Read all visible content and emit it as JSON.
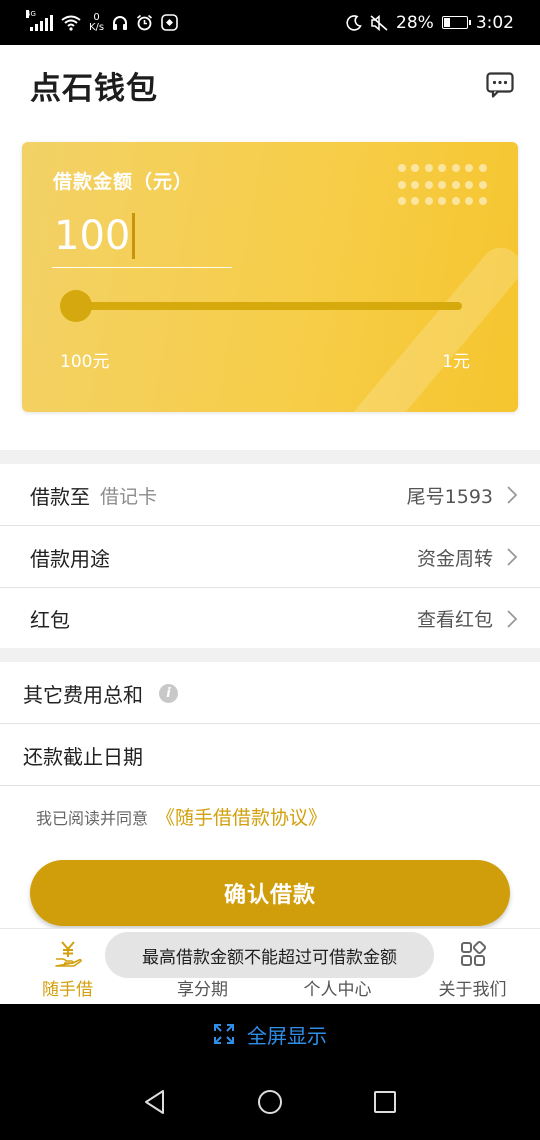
{
  "status_bar": {
    "network": "4G",
    "speed_value": "0",
    "speed_unit": "K/s",
    "battery": "28%",
    "time": "3:02"
  },
  "header": {
    "title": "点石钱包",
    "message_icon": "chat-bubble-icon"
  },
  "card": {
    "amount_label": "借款金额（元）",
    "amount_value": "100",
    "slider_min_label": "100元",
    "slider_max_label": "1元",
    "slider_fraction": 0
  },
  "rows": {
    "loan_to": {
      "label": "借款至",
      "sub": "借记卡",
      "value": "尾号1593"
    },
    "purpose": {
      "label": "借款用途",
      "value": "资金周转"
    },
    "red_packet": {
      "label": "红包",
      "value": "查看红包"
    },
    "other_fees": {
      "label": "其它费用总和",
      "info_icon": "i"
    },
    "due_date": {
      "label": "还款截止日期"
    }
  },
  "agreement": {
    "text": "我已阅读并同意",
    "link": "《随手借借款协议》"
  },
  "confirm_button": "确认借款",
  "toast": "最高借款金额不能超过可借款金额",
  "tabs": [
    {
      "label": "随手借",
      "icon": "yen-hand-icon",
      "active": true
    },
    {
      "label": "享分期",
      "icon": "installment-icon",
      "active": false
    },
    {
      "label": "个人中心",
      "icon": "person-icon",
      "active": false
    },
    {
      "label": "关于我们",
      "icon": "apps-grid-icon",
      "active": false
    }
  ],
  "fullscreen": "全屏显示",
  "colors": {
    "accent": "#D19E0B",
    "card_gradient": [
      "#F2D166",
      "#F6C52E"
    ],
    "link": "#D2A00C",
    "fullscreen_text": "#2F8FE8"
  }
}
